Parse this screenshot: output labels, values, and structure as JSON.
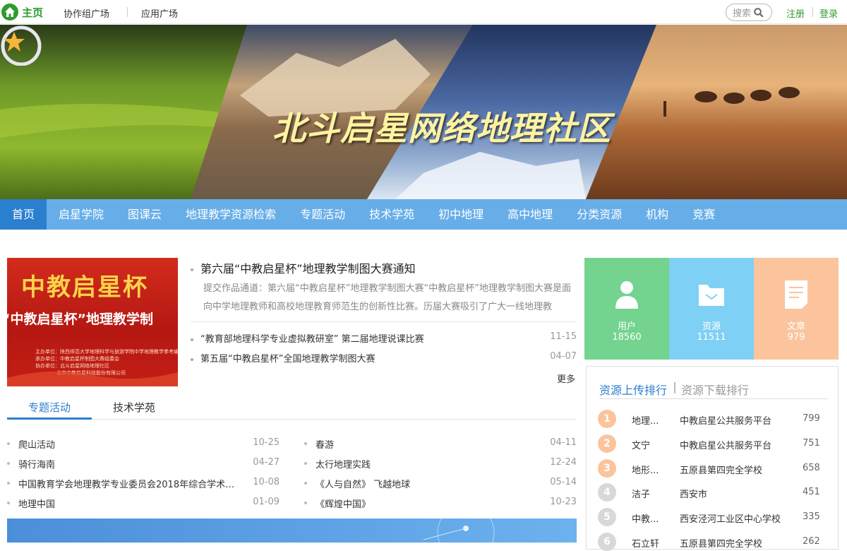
{
  "topbar": {
    "home_label": "主页",
    "links": [
      "协作组广场",
      "应用广场"
    ],
    "search_placeholder": "搜索",
    "register": "注册",
    "login": "登录"
  },
  "banner": {
    "title": "北斗启星网络地理社区"
  },
  "nav": {
    "items": [
      "首页",
      "启星学院",
      "图课云",
      "地理教学资源检索",
      "专题活动",
      "技术学苑",
      "初中地理",
      "高中地理",
      "分类资源",
      "机构",
      "竞赛"
    ]
  },
  "feature": {
    "image_title": "中教启星杯",
    "image_subtitle": "“中教启星杯”地理教学制",
    "image_credits": [
      "主办单位：陕西师范大学地理科学与旅游学院中学地理教学参考编辑部",
      "承办单位：中教启星杯制图大赛组委会",
      "协办单位：北斗启星网络地理社区",
      "北京中教启星科技股份有限公司"
    ],
    "headline": "第六届“中教启星杯”地理教学制图大赛通知",
    "summary": "提交作品通道：第六届“中教启星杯”地理教学制图大赛“中教启星杯”地理教学制图大赛是面向中学地理教师和高校地理教育师范生的创新性比赛。历届大赛吸引了广大一线地理教",
    "news": [
      {
        "title": "“教育部地理科学专业虚拟教研室” 第二届地理说课比赛",
        "date": "11-15"
      },
      {
        "title": "第五届“中教启星杯”全国地理教学制图大赛",
        "date": "04-07"
      }
    ],
    "more": "更多"
  },
  "tabs": {
    "items": [
      "专题活动",
      "技术学苑"
    ],
    "left": [
      {
        "title": "爬山活动",
        "date": "10-25"
      },
      {
        "title": "骑行海南",
        "date": "04-27"
      },
      {
        "title": "中国教育学会地理教学专业委员会2018年综合学术年会",
        "date": "10-08"
      },
      {
        "title": "地理中国",
        "date": "01-09"
      }
    ],
    "right": [
      {
        "title": "春游",
        "date": "04-11"
      },
      {
        "title": "太行地理实践",
        "date": "12-24"
      },
      {
        "title": "《人与自然》 飞越地球",
        "date": "05-14"
      },
      {
        "title": "《辉煌中国》",
        "date": "10-23"
      }
    ]
  },
  "stats": [
    {
      "label": "用户",
      "value": "18560",
      "color": "#73d38f",
      "icon": "user-icon"
    },
    {
      "label": "资源",
      "value": "11511",
      "color": "#7fd0f5",
      "icon": "folder-icon"
    },
    {
      "label": "文章",
      "value": "979",
      "color": "#fbc49c",
      "icon": "document-icon"
    }
  ],
  "ranking": {
    "tab_upload": "资源上传排行",
    "tab_download": "资源下载排行",
    "rows": [
      {
        "rank": "1",
        "name": "地理...",
        "org": "中教启星公共服务平台",
        "count": "799"
      },
      {
        "rank": "2",
        "name": "文宁",
        "org": "中教启星公共服务平台",
        "count": "751"
      },
      {
        "rank": "3",
        "name": "地形...",
        "org": "五原县第四完全学校",
        "count": "658"
      },
      {
        "rank": "4",
        "name": "洁子",
        "org": "西安市",
        "count": "451"
      },
      {
        "rank": "5",
        "name": "中教...",
        "org": "西安泾河工业区中心学校",
        "count": "335"
      },
      {
        "rank": "6",
        "name": "石立轩",
        "org": "五原县第四完全学校",
        "count": "262"
      }
    ],
    "top_color": "#fbc49c",
    "other_color": "#d8d8d8"
  }
}
